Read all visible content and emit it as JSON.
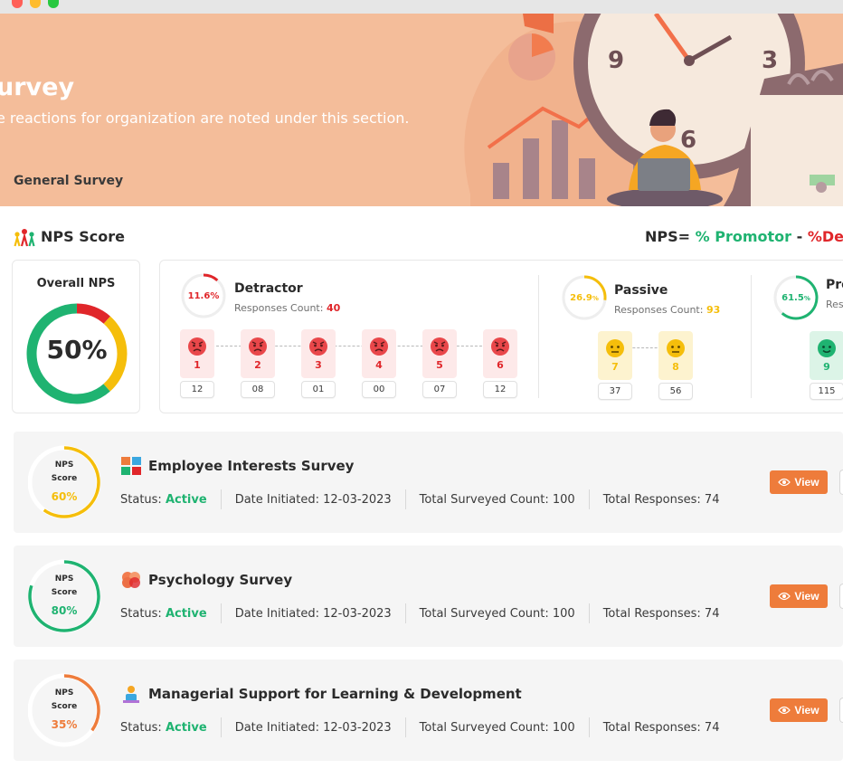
{
  "banner": {
    "title": "urvey",
    "subtitle": "e reactions for organization are noted under this section.",
    "breadcrumb": "General Survey",
    "clock": {
      "nine": "9",
      "three": "3",
      "six": "6"
    }
  },
  "nps_header": {
    "title": "NPS Score",
    "formula_eq": "NPS=",
    "formula_promotor": "% Promotor",
    "formula_minus": "-",
    "formula_detractor": "%Detra"
  },
  "overall": {
    "label": "Overall NPS",
    "value": "50%",
    "ring": {
      "detractor": 0.116,
      "passive": 0.269,
      "promoter": 0.615
    }
  },
  "colors": {
    "detractor": "#e0262a",
    "passive": "#f5be0b",
    "promoter": "#1fb371",
    "accent": "#ee7c3b",
    "banner": "#f4bd9a"
  },
  "groups": {
    "detractor": {
      "title": "Detractor",
      "pct": "11.6%",
      "pct_value": 0.116,
      "count_label": "Responses Count:",
      "count": "40",
      "scores": [
        {
          "num": "1",
          "count": "12"
        },
        {
          "num": "2",
          "count": "08"
        },
        {
          "num": "3",
          "count": "01"
        },
        {
          "num": "4",
          "count": "00"
        },
        {
          "num": "5",
          "count": "07"
        },
        {
          "num": "6",
          "count": "12"
        }
      ]
    },
    "passive": {
      "title": "Passive",
      "pct": "26.9",
      "pct_unit": "%",
      "pct_value": 0.269,
      "count_label": "Responses Count:",
      "count": "93",
      "scores": [
        {
          "num": "7",
          "count": "37"
        },
        {
          "num": "8",
          "count": "56"
        }
      ]
    },
    "promoter": {
      "title": "Pro",
      "pct": "61.5",
      "pct_unit": "%",
      "pct_value": 0.615,
      "count_label": "Res",
      "scores": [
        {
          "num": "9",
          "count": "115"
        }
      ]
    }
  },
  "surveys": [
    {
      "nps_label": "NPS",
      "score_label": "Score",
      "score": "60%",
      "score_value": 0.6,
      "color": "#f5be0b",
      "title": "Employee Interests Survey",
      "icon": "puzzle-icon",
      "status_label": "Status:",
      "status": "Active",
      "date": "Date Initiated: 12-03-2023",
      "surveyed": "Total Surveyed Count: 100",
      "responses": "Total Responses: 74",
      "view_label": "View"
    },
    {
      "nps_label": "NPS",
      "score_label": "Score",
      "score": "80%",
      "score_value": 0.8,
      "color": "#1fb371",
      "title": "Psychology Survey",
      "icon": "brain-icon",
      "status_label": "Status:",
      "status": "Active",
      "date": "Date Initiated: 12-03-2023",
      "surveyed": "Total Surveyed Count: 100",
      "responses": "Total Responses: 74",
      "view_label": "View"
    },
    {
      "nps_label": "NPS",
      "score_label": "Score",
      "score": "35%",
      "score_value": 0.35,
      "color": "#ee7c3b",
      "title": "Managerial Support for Learning & Development",
      "icon": "mentor-icon",
      "status_label": "Status:",
      "status": "Active",
      "date": "Date Initiated: 12-03-2023",
      "surveyed": "Total Surveyed Count: 100",
      "responses": "Total Responses: 74",
      "view_label": "View"
    }
  ]
}
